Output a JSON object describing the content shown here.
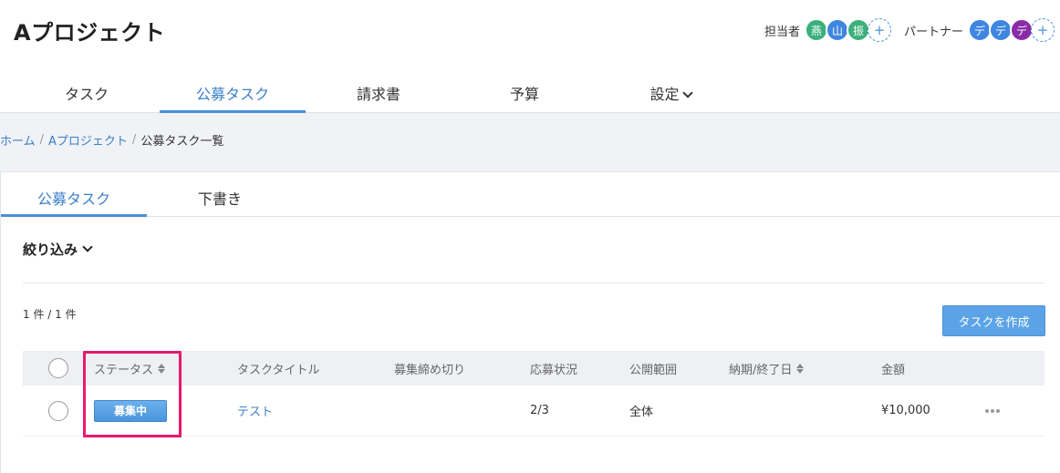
{
  "project": {
    "title": "Aプロジェクト"
  },
  "members": {
    "assignee_label": "担当者",
    "assignees": [
      {
        "initial": "燕",
        "color": "#3bb07b"
      },
      {
        "initial": "山",
        "color": "#3f86e0"
      },
      {
        "initial": "振",
        "color": "#3bb07b"
      }
    ],
    "partner_label": "パートナー",
    "partners": [
      {
        "initial": "デ",
        "color": "#3f86e0"
      },
      {
        "initial": "デ",
        "color": "#3f86e0"
      },
      {
        "initial": "デ",
        "color": "#8a2ca8"
      }
    ],
    "add_symbol": "+"
  },
  "main_tabs": [
    {
      "label": "タスク"
    },
    {
      "label": "公募タスク"
    },
    {
      "label": "請求書"
    },
    {
      "label": "予算"
    },
    {
      "label": "設定"
    }
  ],
  "breadcrumb": {
    "home": "ホーム",
    "project": "Aプロジェクト",
    "current": "公募タスク一覧",
    "separator": "/"
  },
  "sub_tabs": [
    {
      "label": "公募タスク"
    },
    {
      "label": "下書き"
    }
  ],
  "filter": {
    "label": "絞り込み"
  },
  "count": {
    "text": "1 件 / 1 件"
  },
  "create_button": {
    "label": "タスクを作成"
  },
  "table": {
    "headers": {
      "status": "ステータス",
      "title": "タスクタイトル",
      "deadline": "募集締め切り",
      "applications": "応募状況",
      "scope": "公開範囲",
      "due": "納期/終了日",
      "amount": "金額"
    },
    "rows": [
      {
        "status": "募集中",
        "title": "テスト",
        "deadline": "",
        "applications": "2/3",
        "scope": "全体",
        "due": "",
        "amount": "¥10,000"
      }
    ]
  },
  "colors": {
    "accent": "#4a90d9",
    "status_badge": "#5ba3e6",
    "highlight": "#e8196d"
  }
}
